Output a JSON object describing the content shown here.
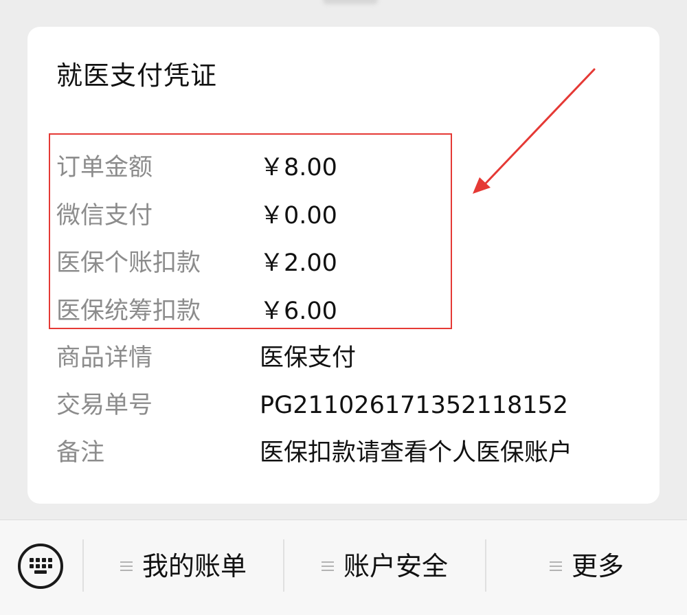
{
  "card": {
    "title": "就医支付凭证",
    "rows": [
      {
        "label": "订单金额",
        "value": "￥8.00"
      },
      {
        "label": "微信支付",
        "value": "￥0.00"
      },
      {
        "label": "医保个账扣款",
        "value": "￥2.00"
      },
      {
        "label": "医保统筹扣款",
        "value": "￥6.00"
      },
      {
        "label": "商品详情",
        "value": "医保支付"
      },
      {
        "label": "交易单号",
        "value": "PG21102617135211815​2"
      },
      {
        "label": "备注",
        "value": "医保扣款请查看个人医保账户"
      }
    ]
  },
  "annotation": {
    "color": "#e53935"
  },
  "bottom_menu": {
    "keyboard_icon": "keyboard-icon",
    "items": [
      {
        "label": "我的账单",
        "icon": "menu-lines-icon"
      },
      {
        "label": "账户安全",
        "icon": "menu-lines-icon"
      },
      {
        "label": "更多",
        "icon": "menu-lines-icon"
      }
    ]
  }
}
